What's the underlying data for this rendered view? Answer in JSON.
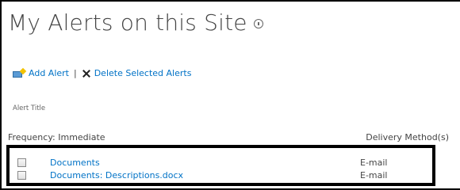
{
  "page": {
    "title": "My Alerts on this Site"
  },
  "toolbar": {
    "add_label": "Add Alert",
    "separator": "|",
    "delete_label": "Delete Selected Alerts"
  },
  "list": {
    "column_title": "Alert Title",
    "frequency_label": "Frequency: Immediate",
    "delivery_header": "Delivery Method(s)",
    "rows": [
      {
        "name": "Documents",
        "method": "E-mail",
        "checked": false
      },
      {
        "name": "Documents: Descriptions.docx",
        "method": "E-mail",
        "checked": false
      }
    ]
  },
  "colors": {
    "link": "#0072c6",
    "text": "#444444",
    "highlight_border": "#000000"
  },
  "icons": {
    "info": "info-icon",
    "add": "add-alert-icon",
    "delete": "delete-x-icon"
  }
}
